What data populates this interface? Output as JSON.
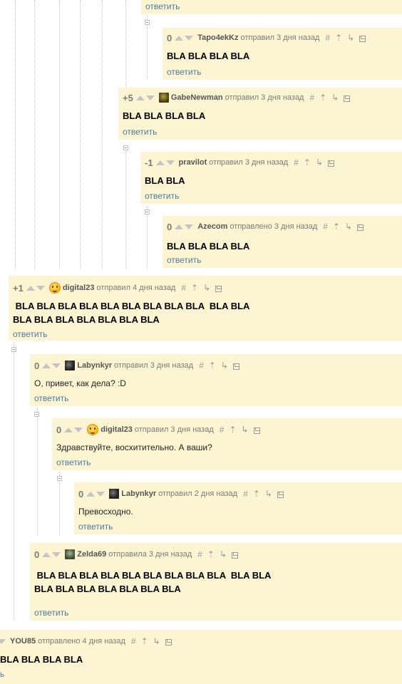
{
  "reply_label": "ответить",
  "actions": [
    "#",
    "⇡",
    "↳"
  ],
  "comments": [
    {
      "id": "c1",
      "score": "0",
      "user": "Tapo4ekKz",
      "meta": "отправил 3 дня назад",
      "text": "BLA BLA BLA BLA",
      "avatar": null
    },
    {
      "id": "c2",
      "score": "+5",
      "user": "GabeNewman",
      "meta": "отправил 3 дня назад",
      "text": "BLA BLA BLA BLA",
      "avatar": "gabe"
    },
    {
      "id": "c3",
      "score": "-1",
      "user": "pravilot",
      "meta": "отправил 3 дня назад",
      "text": "BLA BLA",
      "avatar": null
    },
    {
      "id": "c4",
      "score": "0",
      "user": "Azecom",
      "meta": "отправлено 3 дня назад",
      "text": "BLA BLA BLA BLA",
      "avatar": null
    },
    {
      "id": "c5",
      "score": "+1",
      "user": "digital23",
      "meta": "отправил 4 дня назад",
      "text": " BLA BLA BLA BLA BLA BLA BLA BLA BLA  BLA BLA\nBLA BLA BLA BLA BLA BLA BLA",
      "avatar": "smile"
    },
    {
      "id": "c6",
      "score": "0",
      "user": "Labynkyr",
      "meta": "отправил 3 дня назад",
      "text": "О, привет, как дела? :D",
      "avatar": "dark"
    },
    {
      "id": "c7",
      "score": "0",
      "user": "digital23",
      "meta": "отправил 3 дня назад",
      "text": "Здравствуйте, восхитительно. А ваши?",
      "avatar": "smile"
    },
    {
      "id": "c8",
      "score": "0",
      "user": "Labynkyr",
      "meta": "отправил 2 дня назад",
      "text": "Превосходно.",
      "avatar": "dark"
    },
    {
      "id": "c9",
      "score": "0",
      "user": "Zelda69",
      "meta": "отправила 3 дня назад",
      "text": " BLA BLA BLA BLA BLA BLA BLA BLA BLA  BLA BLA\nBLA BLA BLA BLA BLA BLA BLA",
      "avatar": "zelda"
    },
    {
      "id": "c10",
      "score": "",
      "user": "YOU85",
      "meta": "отправлено 4 дня назад",
      "text": "BLA BLA BLA BLA",
      "avatar": null
    }
  ],
  "partial_reply": "ь"
}
